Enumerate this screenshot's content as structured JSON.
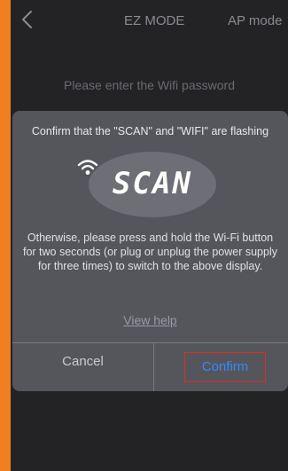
{
  "header": {
    "back_icon": "chevron-left-icon",
    "tabs": [
      {
        "label": "EZ MODE"
      },
      {
        "label": "AP mode"
      }
    ]
  },
  "main": {
    "prompt": "Please enter the Wifi password"
  },
  "dialog": {
    "title": "Confirm that the \"SCAN\" and \"WIFI\" are flashing",
    "display_text": "SCAN",
    "wifi_icon": "wifi-icon",
    "help_text": "Otherwise, please press and hold the Wi-Fi button for two seconds (or plug or unplug the power supply for three times) to switch to the above display.",
    "view_help_label": "View help",
    "cancel_label": "Cancel",
    "confirm_label": "Confirm"
  },
  "colors": {
    "frame": "#f07f22",
    "background": "#232326",
    "dialog": "#55555c",
    "accent": "#2f8cff",
    "highlight_box": "#e02a2a"
  }
}
